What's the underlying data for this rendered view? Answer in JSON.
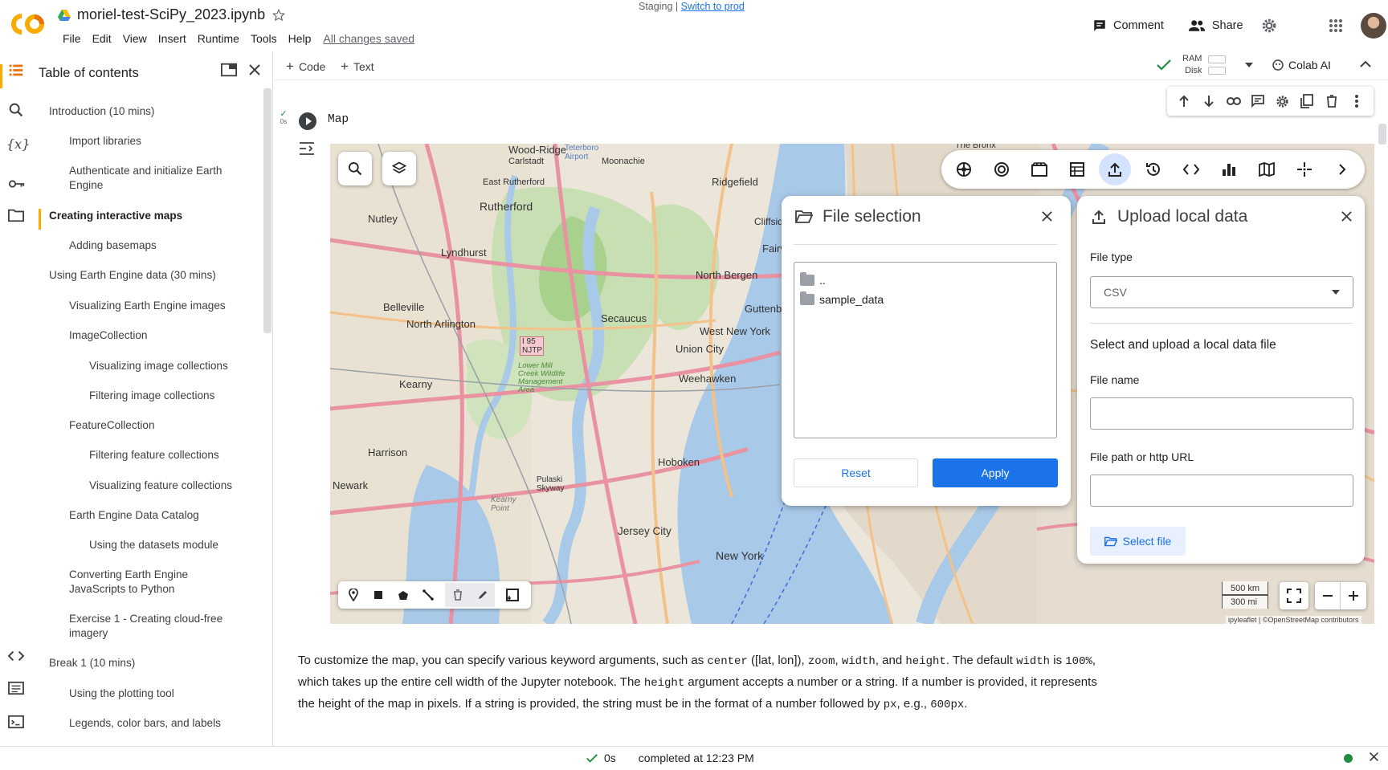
{
  "header": {
    "notebook_name": "moriel-test-SciPy_2023.ipynb",
    "staging_label": "Staging |",
    "switch_link": "Switch to prod",
    "menu": [
      "File",
      "Edit",
      "View",
      "Insert",
      "Runtime",
      "Tools",
      "Help"
    ],
    "save_status": "All changes saved",
    "comment_label": "Comment",
    "share_label": "Share"
  },
  "toc": {
    "title": "Table of contents",
    "items": [
      {
        "label": "Introduction (10 mins)",
        "level": 1
      },
      {
        "label": "Import libraries",
        "level": 2
      },
      {
        "label": "Authenticate and initialize Earth Engine",
        "level": 2
      },
      {
        "label": "Creating interactive maps",
        "level": 1,
        "active": true
      },
      {
        "label": "Adding basemaps",
        "level": 2
      },
      {
        "label": "Using Earth Engine data (30 mins)",
        "level": 1
      },
      {
        "label": "Visualizing Earth Engine images",
        "level": 2
      },
      {
        "label": "ImageCollection",
        "level": 2
      },
      {
        "label": "Visualizing image collections",
        "level": 3
      },
      {
        "label": "Filtering image collections",
        "level": 3
      },
      {
        "label": "FeatureCollection",
        "level": 2
      },
      {
        "label": "Filtering feature collections",
        "level": 3
      },
      {
        "label": "Visualizing feature collections",
        "level": 3
      },
      {
        "label": "Earth Engine Data Catalog",
        "level": 2
      },
      {
        "label": "Using the datasets module",
        "level": 3
      },
      {
        "label": "Converting Earth Engine JavaScripts to Python",
        "level": 2
      },
      {
        "label": "Exercise 1 - Creating cloud-free imagery",
        "level": 2
      },
      {
        "label": "Break 1 (10 mins)",
        "level": 1
      },
      {
        "label": "Using the plotting tool",
        "level": 2
      },
      {
        "label": "Legends, color bars, and labels",
        "level": 2
      }
    ]
  },
  "toolbar": {
    "add_code": "Code",
    "add_text": "Text",
    "ram_label": "RAM",
    "disk_label": "Disk",
    "colab_ai": "Colab AI"
  },
  "cell": {
    "exec_time": "0s",
    "title": "Map"
  },
  "map": {
    "labels": [
      "Wood-Ridge",
      "Carlstadt",
      "Teterboro Airport",
      "Moonachie",
      "Ridgefield",
      "East Rutherford",
      "Rutherford",
      "Nutley",
      "Lyndhurst",
      "Cliffside",
      "Fairview",
      "North Bergen",
      "Guttenberg",
      "Belleville",
      "North Arlington",
      "Secaucus",
      "West New York",
      "Union City",
      "Kearny",
      "Weehawken",
      "Harrison",
      "Hoboken",
      "Newark",
      "Pulaski Skyway",
      "Kearny Point",
      "Jersey City",
      "New York",
      "I 95 NJTP",
      "Lower Mill Creek Wildlife Management Area",
      "The Bronx"
    ],
    "file_selection": {
      "title": "File selection",
      "entries": [
        "..",
        "sample_data"
      ],
      "reset": "Reset",
      "apply": "Apply"
    },
    "upload": {
      "title": "Upload local data",
      "file_type_label": "File type",
      "file_type_value": "CSV",
      "section_title": "Select and upload a local data file",
      "file_name_label": "File name",
      "file_path_label": "File path or http URL",
      "select_file": "Select file"
    },
    "scale_km": "500 km",
    "scale_mi": "300 mi",
    "attribution": "ipyleaflet | ©OpenStreetMap contributors"
  },
  "markdown": {
    "p1": "To customize the map, you can specify various keyword arguments, such as ",
    "c1": "center",
    "p2": " ([lat, lon]), ",
    "c2": "zoom",
    "p3": ", ",
    "c3": "width",
    "p4": ", and ",
    "c4": "height",
    "p5": ". The default ",
    "c5": "width",
    "p6": " is ",
    "c6": "100%",
    "p7": ", which takes up the entire cell width of the Jupyter notebook. The ",
    "c7": "height",
    "p8": " argument accepts a number or a string. If a number is provided, it represents the height of the map in pixels. If a string is provided, the string must be in the format of a number followed by ",
    "c8": "px",
    "p9": ", e.g., ",
    "c9": "600px",
    "p10": "."
  },
  "status": {
    "time": "0s",
    "completed": "completed at 12:23 PM"
  },
  "colors": {
    "accent": "#1a73e8",
    "toc_active": "#f9ab00",
    "status_ok": "#1e8e3e"
  }
}
